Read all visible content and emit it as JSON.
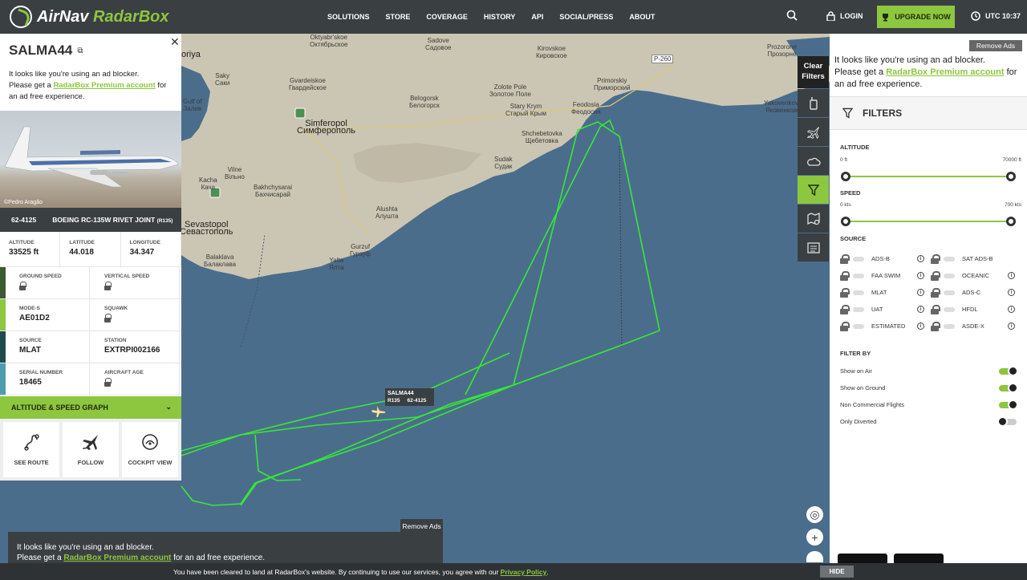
{
  "header": {
    "brand_main": "AirNav",
    "brand_sub": "RadarBox",
    "nav": [
      "SOLUTIONS",
      "STORE",
      "COVERAGE",
      "HISTORY",
      "API",
      "SOCIAL/PRESS",
      "ABOUT"
    ],
    "login": "LOGIN",
    "upgrade": "UPGRADE NOW",
    "utc": "UTC 10:37"
  },
  "flight": {
    "callsign": "SALMA44",
    "ad_line1": "It looks like you're using an ad blocker.",
    "ad_line2_pre": "Please get a ",
    "ad_link": "RadarBox Premium account",
    "ad_line2_post": " for an ad free experience.",
    "photo_credit": "©Pedro Aragão",
    "registration": "62-4125",
    "aircraft_type": "BOEING RC-135W RIVET JOINT",
    "aircraft_code": "(R135)",
    "altitude_label": "ALTITUDE",
    "altitude": "33525 ft",
    "latitude_label": "LATITUDE",
    "latitude": "44.018",
    "longitude_label": "LONGITUDE",
    "longitude": "34.347",
    "ground_speed_label": "GROUND SPEED",
    "vertical_speed_label": "VERTICAL SPEED",
    "mode_s_label": "MODE-S",
    "mode_s": "AE01D2",
    "squawk_label": "SQUAWK",
    "source_label": "SOURCE",
    "source": "MLAT",
    "station_label": "STATION",
    "station": "EXTRPI002166",
    "serial_label": "SERIAL NUMBER",
    "serial": "18465",
    "age_label": "AIRCRAFT AGE",
    "graph_label": "ALTITUDE & SPEED GRAPH",
    "actions": [
      "SEE ROUTE",
      "FOLLOW",
      "COCKPIT VIEW"
    ],
    "map_label_callsign": "SALMA44",
    "map_label_type": "R135",
    "map_label_reg": "62-4125"
  },
  "map_labels": [
    {
      "text": "Oktyabr'skoe\nОктябрьское",
      "big": false
    },
    {
      "text": "Sadove\nСадовое",
      "big": false
    },
    {
      "text": "Kirovskoe\nКировское",
      "big": false
    },
    {
      "text": "Prozorone\nПрозорне",
      "big": false
    },
    {
      "text": "oriya",
      "big": true
    },
    {
      "text": "Saky\nСаки",
      "big": false
    },
    {
      "text": "Gvardeiskoe\nГвардейское",
      "big": false
    },
    {
      "text": "Belogorsk\nБелогорск",
      "big": false
    },
    {
      "text": "Zolote Pole\nЗолотое Поле",
      "big": false
    },
    {
      "text": "Primorskiy\nПриморский",
      "big": false
    },
    {
      "text": "Yakovenkovo\nЯковенково",
      "big": false
    },
    {
      "text": "Gulf of\nЗалив",
      "big": false
    },
    {
      "text": "Simferopol\nСимферополь",
      "big": true
    },
    {
      "text": "Stary Krym\nСтарый Крым",
      "big": false
    },
    {
      "text": "Feodosia\nФеодосия",
      "big": false
    },
    {
      "text": "Shchebetovka\nЩебетовка",
      "big": false
    },
    {
      "text": "Sudak\nСудак",
      "big": false
    },
    {
      "text": "Vilne\nВільно",
      "big": false
    },
    {
      "text": "Kacha\nКача",
      "big": false
    },
    {
      "text": "Bakhchysarai\nБахчисарай",
      "big": false
    },
    {
      "text": "Alushta\nАлушта",
      "big": false
    },
    {
      "text": "Sevastopol\nСевастополь",
      "big": true
    },
    {
      "text": "Balaklava\nБалаклава",
      "big": false
    },
    {
      "text": "Gurzuf\nГурзуф",
      "big": false
    },
    {
      "text": "Yalta\nЯлта",
      "big": false
    },
    {
      "text": "P-260",
      "big": false
    }
  ],
  "tools": {
    "clear_filters": "Clear Filters",
    "icons": [
      "radio-icon",
      "plane-icon",
      "weather-icon",
      "filter-icon",
      "map-settings-icon",
      "news-icon"
    ]
  },
  "right": {
    "remove_ads": "Remove Ads",
    "ad_line1": "It looks like you're using an ad blocker.",
    "ad_line2_pre": "Please get a ",
    "ad_link": "RadarBox Premium account",
    "ad_line2_post": " for an ad free experience.",
    "filters_title": "FILTERS",
    "altitude": "ALTITUDE",
    "alt_min": "0 ft",
    "alt_max": "70000 ft",
    "speed": "SPEED",
    "spd_min": "0 kts",
    "spd_max": "700 kts",
    "source": "SOURCE",
    "sources_left": [
      "ADS-B",
      "FAA SWIM",
      "MLAT",
      "UAT",
      "ESTIMATED"
    ],
    "sources_right": [
      "SAT ADS-B",
      "OCEANIC",
      "ADS-C",
      "HFDL",
      "ASDE-X"
    ],
    "filter_by": "FILTER BY",
    "filter_items": [
      {
        "label": "Show on Air",
        "on": true
      },
      {
        "label": "Show on Ground",
        "on": true
      },
      {
        "label": "Non Commercial Flights",
        "on": true
      },
      {
        "label": "Only Diverted",
        "on": false
      }
    ]
  },
  "bottom_ad": {
    "remove_ads": "Remove Ads",
    "line1": "It looks like you're using an ad blocker.",
    "line2_pre": "Please get a ",
    "link": "RadarBox Premium account",
    "line2_post": " for an ad free experience."
  },
  "cookie": {
    "text": "You have been cleared to land at RadarBox's website. By continuing to use our services, you agree with our ",
    "link": "Privacy Policy",
    "end": ".",
    "hide": "HIDE"
  },
  "colors": {
    "accent": "#8dc63f",
    "track": "#36e836",
    "sea": "#4b6d8c",
    "land": "#c9c4b2",
    "dark": "#3a3f42"
  }
}
